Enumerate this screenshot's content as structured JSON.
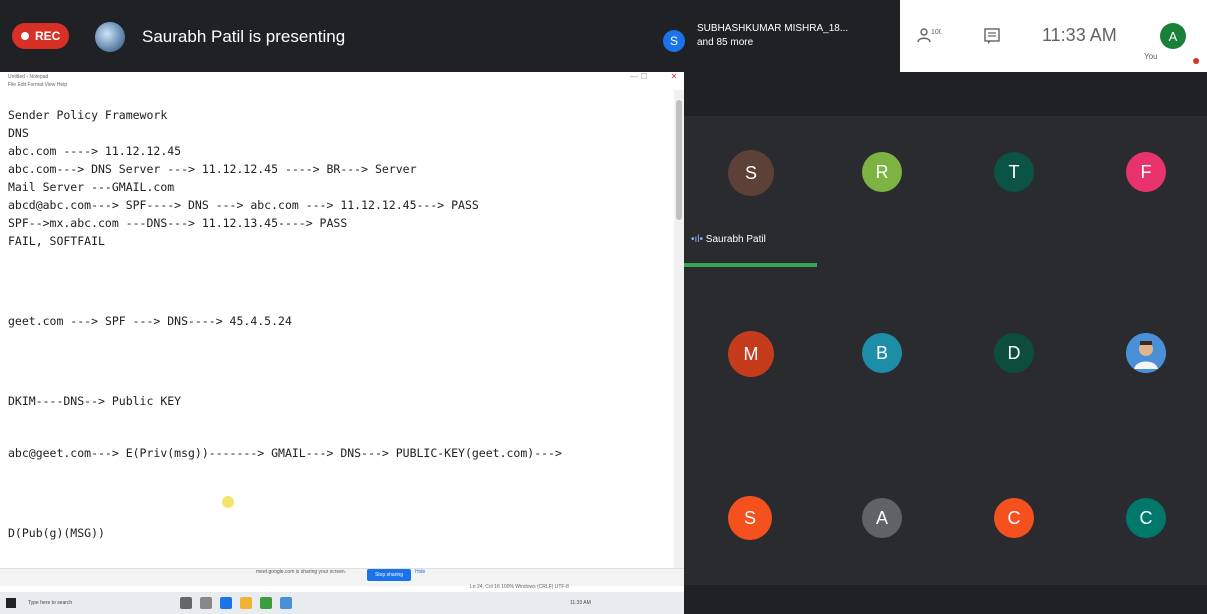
{
  "meet": {
    "rec_label": "REC",
    "presenting_text": "Saurabh Patil is presenting",
    "participants_line1": "SUBHASHKUMAR MISHRA_18...",
    "participants_line2": "and 85 more",
    "participant_initial": "S",
    "people_count": "100",
    "time": "11:33 AM",
    "you_initial": "A",
    "you_label": "You"
  },
  "editor": {
    "window_title": "Untitled - Notepad",
    "menu": "File  Edit  Format  View  Help",
    "lines": [
      "Sender Policy Framework",
      "DNS",
      "abc.com ----> 11.12.12.45",
      "abc.com---> DNS Server ---> 11.12.12.45 ----> BR---> Server",
      "Mail Server ---GMAIL.com",
      "abcd@abc.com---> SPF----> DNS ---> abc.com ---> 11.12.12.45---> PASS",
      "SPF-->mx.abc.com ---DNS---> 11.12.13.45----> PASS",
      "FAIL, SOFTFAIL",
      "geet.com ---> SPF ---> DNS----> 45.4.5.24",
      "DKIM----DNS--> Public KEY",
      "abc@geet.com---> E(Priv(msg))-------> GMAIL---> DNS---> PUBLIC-KEY(geet.com)--->",
      "D(Pub(g)(MSG))"
    ],
    "share_message": "meet.google.com is sharing your screen.",
    "stop_sharing": "Stop sharing",
    "hide": "Hide",
    "status_right": "Ln 24, Col 16    100%    Windows (CRLF)    UTF-8",
    "taskbar_search": "Type here to search",
    "taskbar_tray": "11:33 AM"
  },
  "grid": {
    "speaker_name": "Saurabh Patil",
    "tiles": [
      {
        "initial": "S",
        "color": "#5d4037"
      },
      {
        "initial": "R",
        "color": "#7cb342"
      },
      {
        "initial": "T",
        "color": "#0b5345"
      },
      {
        "initial": "F",
        "color": "#e8336d"
      },
      {
        "initial": "M",
        "color": "#c43c1b"
      },
      {
        "initial": "B",
        "color": "#1e8ea8"
      },
      {
        "initial": "D",
        "color": "#0d4d3d"
      },
      {
        "initial": "",
        "color": "#4a90d9"
      },
      {
        "initial": "S",
        "color": "#f4511e"
      },
      {
        "initial": "A",
        "color": "#5f6368"
      },
      {
        "initial": "C",
        "color": "#f4511e"
      },
      {
        "initial": "C",
        "color": "#00796b"
      }
    ]
  },
  "colors": {
    "rec": "#d93025",
    "bar_dark": "#202124",
    "speaking": "#34a853"
  }
}
